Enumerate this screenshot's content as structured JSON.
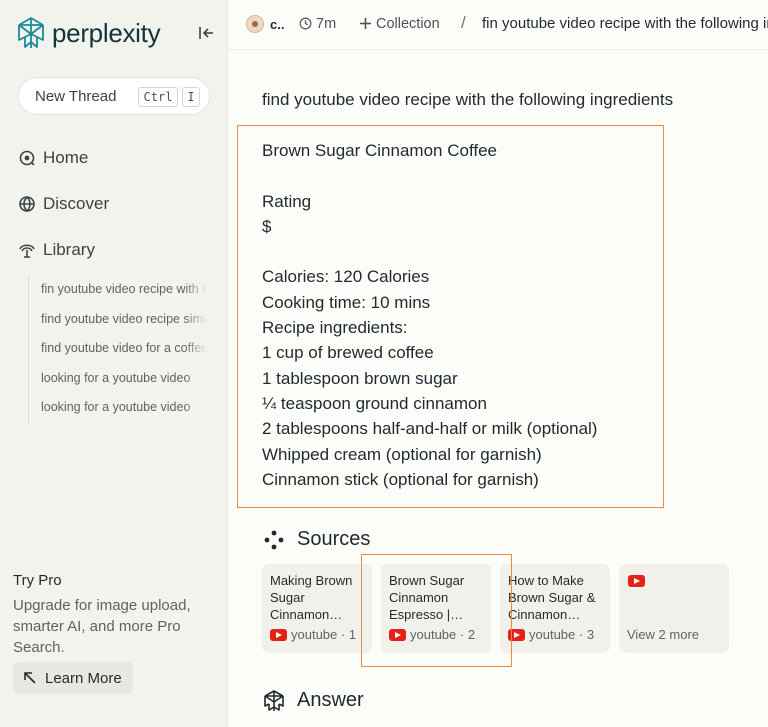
{
  "sidebar": {
    "brand": "perplexity",
    "new_thread": {
      "label": "New Thread",
      "shortcut": [
        "Ctrl",
        "I"
      ]
    },
    "nav": [
      {
        "label": "Home",
        "icon": "home-icon"
      },
      {
        "label": "Discover",
        "icon": "globe-icon"
      },
      {
        "label": "Library",
        "icon": "library-icon"
      }
    ],
    "library_items": [
      "fin youtube video recipe with the following ingredients",
      "find youtube video recipe similar",
      "find youtube video for a coffee",
      "looking for a youtube video",
      "looking for a youtube video"
    ],
    "try_pro": {
      "title": "Try Pro",
      "description": "Upgrade for image upload, smarter AI, and more Pro Search.",
      "learn_more": "Learn More"
    }
  },
  "topbar": {
    "user": "c..",
    "time": "7m",
    "collection": "Collection",
    "separator": "/",
    "thread_title": "fin youtube video recipe with the following ingredients"
  },
  "main": {
    "query": "find youtube video recipe with the following ingredients",
    "recipe_lines": [
      "Brown Sugar Cinnamon Coffee",
      "",
      "Rating",
      "$",
      "",
      "Calories: 120 Calories",
      "Cooking time: 10 mins",
      "Recipe ingredients:",
      "1 cup of brewed coffee",
      "1 tablespoon brown sugar",
      "¼ teaspoon ground cinnamon",
      "2 tablespoons half-and-half or milk (optional)",
      "Whipped cream (optional for garnish)",
      "Cinnamon stick (optional for garnish)"
    ],
    "sources_heading": "Sources",
    "sources": [
      {
        "title": "Making Brown Sugar Cinnamon…",
        "source": "youtube · 1"
      },
      {
        "title": "Brown Sugar Cinnamon Espresso |…",
        "source": "youtube · 2"
      },
      {
        "title": "How to Make Brown Sugar & Cinnamon…",
        "source": "youtube · 3"
      }
    ],
    "view_more": "View 2 more",
    "answer_heading": "Answer"
  },
  "colors": {
    "brand": "#13343b",
    "highlight": "#f0883e",
    "youtube": "#e62117",
    "sidebar_bg": "#f3f3ee"
  }
}
